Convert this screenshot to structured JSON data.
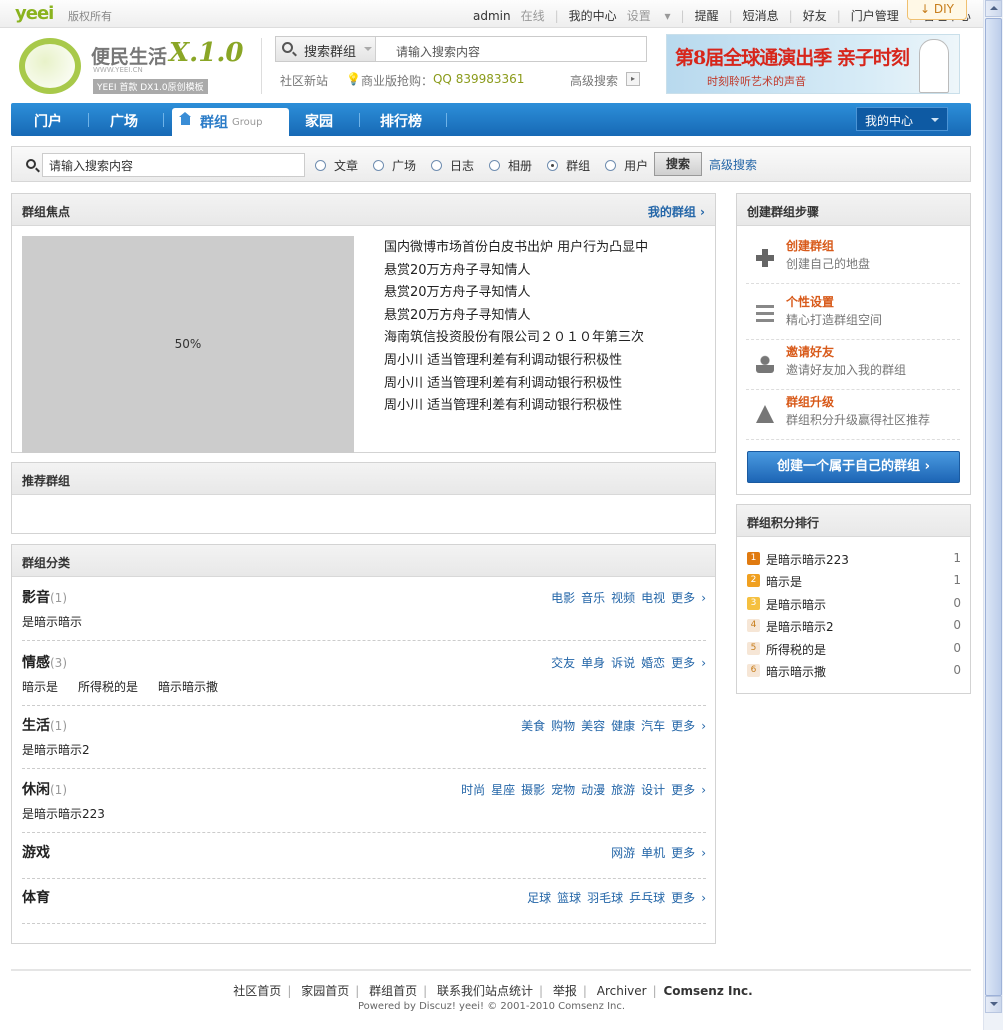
{
  "topbar": {
    "logo": "yeei",
    "copyright": "版权所有",
    "user": "admin",
    "online": "在线",
    "my_center": "我的中心",
    "settings": "设置",
    "remind": "提醒",
    "messages": "短消息",
    "friends": "好友",
    "portal_admin": "门户管理",
    "admin_center": "管理中心",
    "diy": "DIY"
  },
  "header": {
    "logo_title": "便民生活",
    "logo_version": "X.1.0",
    "logo_url": "WWW.YEEI.CN",
    "logo_tag": "YEEI 首款 DX1.0原创模板",
    "search_type": "搜索群组",
    "search_placeholder": "请输入搜索内容",
    "community_new": "社区新站",
    "business_label": "商业版抢购：",
    "business_qq": "QQ 839983361",
    "advanced_search": "高级搜索",
    "banner_title": "第8届全球通演出季 亲子时刻",
    "banner_sub": "时刻聆听艺术的声音"
  },
  "nav": {
    "items": [
      "门户",
      "广场",
      "群组",
      "家园",
      "排行榜"
    ],
    "active_sub": "Group",
    "my_center": "我的中心"
  },
  "search2": {
    "placeholder": "请输入搜索内容",
    "options": [
      "文章",
      "广场",
      "日志",
      "相册",
      "群组",
      "用户"
    ],
    "selected": "群组",
    "button": "搜索",
    "advanced": "高级搜索"
  },
  "focus": {
    "title": "群组焦点",
    "more": "我的群组",
    "image_label": "50%",
    "headlines": [
      "国内微博市场首份白皮书出炉 用户行为凸显中",
      "悬赏20万方舟子寻知情人",
      "悬赏20万方舟子寻知情人",
      "悬赏20万方舟子寻知情人",
      "海南筑信投资股份有限公司２０１０年第三次",
      "周小川 适当管理利差有利调动银行积极性",
      "周小川 适当管理利差有利调动银行积极性",
      "周小川 适当管理利差有利调动银行积极性"
    ]
  },
  "recommend": {
    "title": "推荐群组"
  },
  "categories": {
    "title": "群组分类",
    "more": "更多",
    "list": [
      {
        "name": "影音",
        "count": "(1)",
        "tags": [
          "电影",
          "音乐",
          "视频",
          "电视"
        ],
        "groups": [
          "是暗示暗示"
        ]
      },
      {
        "name": "情感",
        "count": "(3)",
        "tags": [
          "交友",
          "单身",
          "诉说",
          "婚恋"
        ],
        "groups": [
          "暗示是",
          "所得税的是",
          "暗示暗示撒"
        ]
      },
      {
        "name": "生活",
        "count": "(1)",
        "tags": [
          "美食",
          "购物",
          "美容",
          "健康",
          "汽车"
        ],
        "groups": [
          "是暗示暗示2"
        ]
      },
      {
        "name": "休闲",
        "count": "(1)",
        "tags": [
          "时尚",
          "星座",
          "摄影",
          "宠物",
          "动漫",
          "旅游",
          "设计"
        ],
        "groups": [
          "是暗示暗示223"
        ]
      },
      {
        "name": "游戏",
        "count": "",
        "tags": [
          "网游",
          "单机"
        ],
        "groups": []
      },
      {
        "name": "体育",
        "count": "",
        "tags": [
          "足球",
          "篮球",
          "羽毛球",
          "乒乓球"
        ],
        "groups": []
      }
    ]
  },
  "steps": {
    "title": "创建群组步骤",
    "items": [
      {
        "title": "创建群组",
        "desc": "创建自己的地盘",
        "icon": "plus-icon"
      },
      {
        "title": "个性设置",
        "desc": "精心打造群组空间",
        "icon": "list-icon"
      },
      {
        "title": "邀请好友",
        "desc": "邀请好友加入我的群组",
        "icon": "user-icon"
      },
      {
        "title": "群组升级",
        "desc": "群组积分升级赢得社区推荐",
        "icon": "arrow-up-icon"
      }
    ],
    "create_button": "创建一个属于自己的群组"
  },
  "ranking": {
    "title": "群组积分排行",
    "rows": [
      {
        "rank": "1",
        "name": "是暗示暗示223",
        "score": "1",
        "color": "#e07a10"
      },
      {
        "rank": "2",
        "name": "暗示是",
        "score": "1",
        "color": "#f0a020"
      },
      {
        "rank": "3",
        "name": "是暗示暗示",
        "score": "0",
        "color": "#f5c040"
      },
      {
        "rank": "4",
        "name": "是暗示暗示2",
        "score": "0",
        "color": "#f6e6d6"
      },
      {
        "rank": "5",
        "name": "所得税的是",
        "score": "0",
        "color": "#f6e6d6"
      },
      {
        "rank": "6",
        "name": "暗示暗示撒",
        "score": "0",
        "color": "#f6e6d6"
      }
    ]
  },
  "footer": {
    "links": [
      "社区首页",
      "家园首页",
      "群组首页",
      "联系我们站点统计",
      "举报",
      "Archiver"
    ],
    "company": "Comsenz Inc.",
    "powered": "Powered by Discuz! yeei! © 2001-2010 Comsenz Inc."
  }
}
